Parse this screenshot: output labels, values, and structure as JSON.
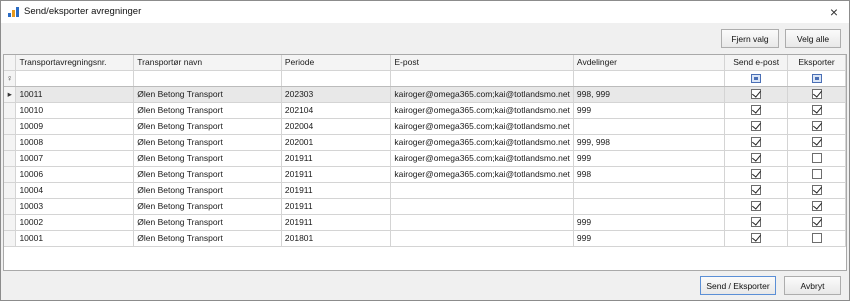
{
  "window": {
    "title": "Send/eksporter avregninger",
    "close_icon": "×"
  },
  "toolbar": {
    "deselect_label": "Fjern valg",
    "select_all_label": "Velg alle"
  },
  "grid": {
    "columns": [
      "Transportavregningsnr.",
      "Transportør navn",
      "Periode",
      "E-post",
      "Avdelinger",
      "Send e-post",
      "Eksporter"
    ],
    "filter_icon": "♀",
    "current_row_icon": "▸",
    "rows": [
      {
        "nr": "10011",
        "name": "Ølen Betong Transport",
        "period": "202303",
        "email": "kairoger@omega365.com;kai@totlandsmo.net",
        "dept": "998, 999",
        "send": true,
        "export": true
      },
      {
        "nr": "10010",
        "name": "Ølen Betong Transport",
        "period": "202104",
        "email": "kairoger@omega365.com;kai@totlandsmo.net",
        "dept": "999",
        "send": true,
        "export": true
      },
      {
        "nr": "10009",
        "name": "Ølen Betong Transport",
        "period": "202004",
        "email": "kairoger@omega365.com;kai@totlandsmo.net",
        "dept": "",
        "send": true,
        "export": true
      },
      {
        "nr": "10008",
        "name": "Ølen Betong Transport",
        "period": "202001",
        "email": "kairoger@omega365.com;kai@totlandsmo.net",
        "dept": "999, 998",
        "send": true,
        "export": true
      },
      {
        "nr": "10007",
        "name": "Ølen Betong Transport",
        "period": "201911",
        "email": "kairoger@omega365.com;kai@totlandsmo.net",
        "dept": "999",
        "send": true,
        "export": false
      },
      {
        "nr": "10006",
        "name": "Ølen Betong Transport",
        "period": "201911",
        "email": "kairoger@omega365.com;kai@totlandsmo.net",
        "dept": "998",
        "send": true,
        "export": false
      },
      {
        "nr": "10004",
        "name": "Ølen Betong Transport",
        "period": "201911",
        "email": "",
        "dept": "",
        "send": true,
        "export": true
      },
      {
        "nr": "10003",
        "name": "Ølen Betong Transport",
        "period": "201911",
        "email": "",
        "dept": "",
        "send": true,
        "export": true
      },
      {
        "nr": "10002",
        "name": "Ølen Betong Transport",
        "period": "201911",
        "email": "",
        "dept": "999",
        "send": true,
        "export": true
      },
      {
        "nr": "10001",
        "name": "Ølen Betong Transport",
        "period": "201801",
        "email": "",
        "dept": "999",
        "send": true,
        "export": false
      }
    ]
  },
  "footer": {
    "send_export_label": "Send / Eksporter",
    "cancel_label": "Avbryt"
  }
}
